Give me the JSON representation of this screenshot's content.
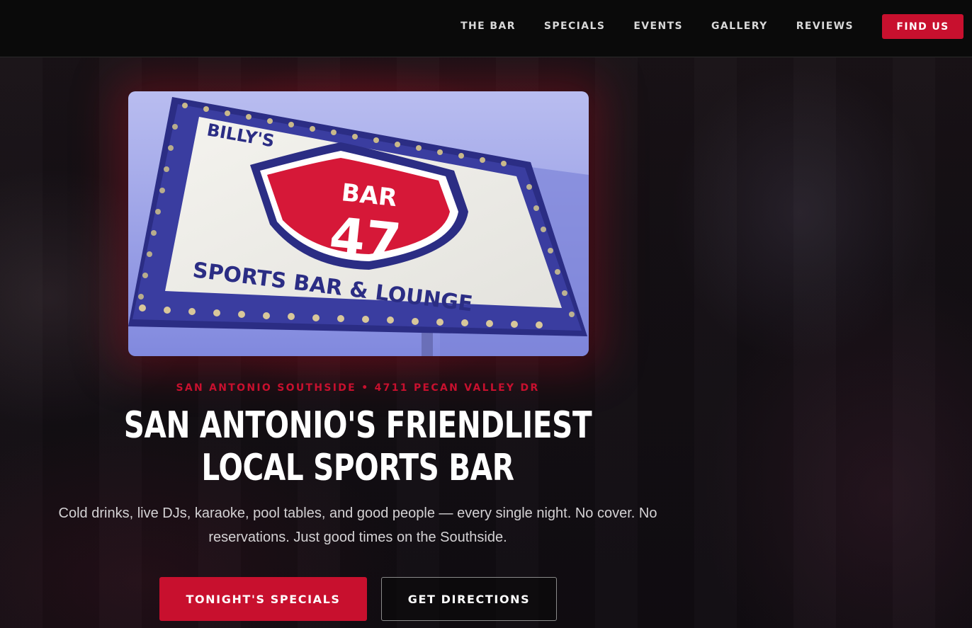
{
  "nav": {
    "links": [
      "THE BAR",
      "SPECIALS",
      "EVENTS",
      "GALLERY",
      "REVIEWS"
    ],
    "cta": "FIND US"
  },
  "hero": {
    "sign": {
      "top_text": "BILLY'S",
      "badge_word": "BAR",
      "badge_number": "47",
      "bottom_text": "SPORTS BAR & LOUNGE"
    },
    "kicker": "SAN ANTONIO SOUTHSIDE • 4711 PECAN VALLEY DR",
    "headline_line1": "SAN ANTONIO'S FRIENDLIEST",
    "headline_line2": "LOCAL SPORTS BAR",
    "subtext": "Cold drinks, live DJs, karaoke, pool tables, and good people — every single night. No cover. No reservations. Just good times on the Southside.",
    "primary_button": "TONIGHT'S SPECIALS",
    "secondary_button": "GET DIRECTIONS"
  },
  "colors": {
    "accent": "#c8102e",
    "nav_bg": "#0a0a0a",
    "page_bg": "#120d12",
    "sign_blue": "#2d2f8a",
    "sky": "#8f97e6"
  }
}
